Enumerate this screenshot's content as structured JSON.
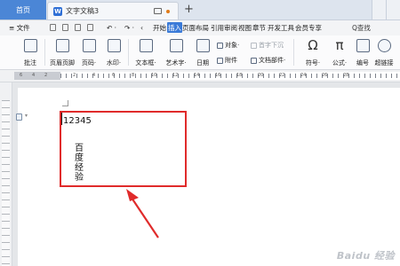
{
  "titlebar": {
    "home_tab": "首页",
    "doc_badge": "W",
    "doc_tab_title": "文字文稿3",
    "add_tab": "+"
  },
  "menubar": {
    "file_label": "≡ 文件",
    "items": [
      "开始",
      "插入",
      "页面布局",
      "引用",
      "审阅",
      "视图",
      "章节",
      "开发工具",
      "会员专享"
    ],
    "active_item": "插入",
    "search_label": "Q查找"
  },
  "ribbon": {
    "comment": "批注",
    "header_footer": "页眉页脚",
    "page_number": "页码·",
    "watermark": "水印·",
    "text_box": "文本框·",
    "art_text": "艺术字·",
    "date": "日期",
    "object": "对象·",
    "drop_cap": "首字下沉",
    "attachment": "附件",
    "doc_parts": "文档部件·",
    "symbol": "符号·",
    "formula": "公式·",
    "numbering": "编号",
    "hyperlink": "超链接",
    "symbol_glyph": "Ω",
    "formula_glyph": "π"
  },
  "ruler": {
    "labels": [
      "6",
      "4",
      "2",
      "2",
      "4",
      "6",
      "8",
      "10",
      "12",
      "14",
      "16",
      "18",
      "20",
      "22",
      "24",
      "26",
      "28"
    ]
  },
  "document": {
    "line1": "12345",
    "vertical_text": [
      "百",
      "度",
      "经",
      "验"
    ]
  },
  "watermark_text": "Baidu 经验",
  "colors": {
    "accent": "#3a7ad8",
    "highlight": "#e02b2b",
    "home_tab": "#4b86d6"
  }
}
